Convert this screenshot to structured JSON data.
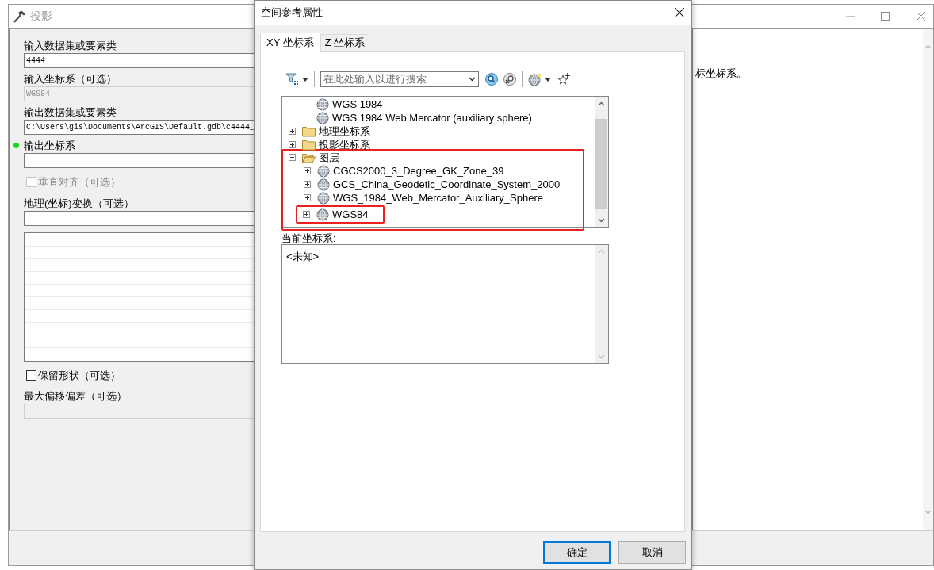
{
  "tool_window": {
    "title": "投影",
    "help_text": "标坐标系。",
    "fields": [
      {
        "kind": "text",
        "label": "输入数据集或要素类",
        "value": "4444",
        "disabled": false,
        "required": false
      },
      {
        "kind": "text",
        "label": "输入坐标系（可选）",
        "value": "WGS84",
        "disabled": true,
        "required": false
      },
      {
        "kind": "text",
        "label": "输出数据集或要素类",
        "value": "C:\\Users\\gis\\Documents\\ArcGIS\\Default.gdb\\c4444_",
        "disabled": false,
        "required": false
      },
      {
        "kind": "text",
        "label": "输出坐标系",
        "disabled": false,
        "required": true
      },
      {
        "kind": "checkbox",
        "label": "垂直对齐（可选）",
        "checked": false,
        "disabled": true
      },
      {
        "kind": "list",
        "label": "地理(坐标)变换（可选）"
      },
      {
        "kind": "checkbox",
        "label": "保留形状（可选）",
        "checked": false,
        "disabled": false
      },
      {
        "kind": "text",
        "label": "最大偏移偏差（可选）",
        "disabled": true,
        "required": false
      }
    ]
  },
  "dialog": {
    "title": "空间参考属性",
    "tabs": [
      {
        "label": "XY 坐标系",
        "selected": true
      },
      {
        "label": "Z 坐标系",
        "selected": false
      }
    ],
    "search": {
      "placeholder": "在此处输入以进行搜索"
    },
    "tree": {
      "orphan_rows": [
        {
          "label": "WGS 1984",
          "kind": "globe"
        },
        {
          "label": "WGS 1984 Web Mercator (auxiliary sphere)",
          "kind": "globe"
        }
      ],
      "nodes": [
        {
          "label": "地理坐标系",
          "kind": "folder",
          "expandable": true,
          "expanded": false,
          "highlighted": false
        },
        {
          "label": "投影坐标系",
          "kind": "folder",
          "expandable": true,
          "expanded": false,
          "highlighted": false
        },
        {
          "label": "图层",
          "kind": "folder",
          "expandable": true,
          "expanded": true,
          "highlighted": true,
          "children": [
            {
              "label": "CGCS2000_3_Degree_GK_Zone_39",
              "kind": "globe",
              "expandable": true,
              "expanded": false,
              "highlighted": false
            },
            {
              "label": "GCS_China_Geodetic_Coordinate_System_2000",
              "kind": "globe",
              "expandable": true,
              "expanded": false,
              "highlighted": false
            },
            {
              "label": "WGS_1984_Web_Mercator_Auxiliary_Sphere",
              "kind": "globe",
              "expandable": true,
              "expanded": false,
              "highlighted": false
            },
            {
              "label": "WGS84",
              "kind": "globe",
              "expandable": true,
              "expanded": false,
              "highlighted": true
            }
          ]
        }
      ]
    },
    "current_label": "当前坐标系:",
    "current_value": "<未知>",
    "buttons": [
      {
        "label": "确定",
        "default": true
      },
      {
        "label": "取消",
        "default": false
      }
    ]
  }
}
